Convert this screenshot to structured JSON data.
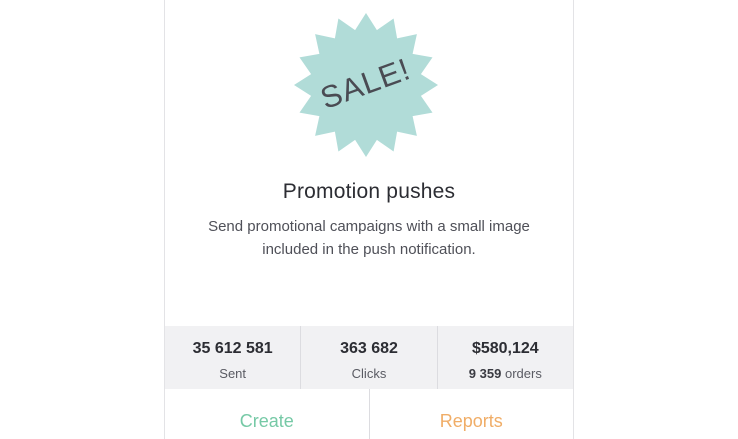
{
  "card": {
    "badge": {
      "text": "SALE!",
      "color": "#b1dcd8",
      "text_color": "#4a4b53"
    },
    "title": "Promotion pushes",
    "description": "Send promotional campaigns with a small image included in the push notification."
  },
  "stats": [
    {
      "value": "35 612 581",
      "label": "Sent"
    },
    {
      "value": "363 682",
      "label": "Clicks"
    },
    {
      "value": "$580,124",
      "label_bold": "9 359",
      "label": "orders"
    }
  ],
  "actions": {
    "create_label": "Create",
    "reports_label": "Reports",
    "create_color": "#76c9a6",
    "reports_color": "#f0ad67"
  }
}
